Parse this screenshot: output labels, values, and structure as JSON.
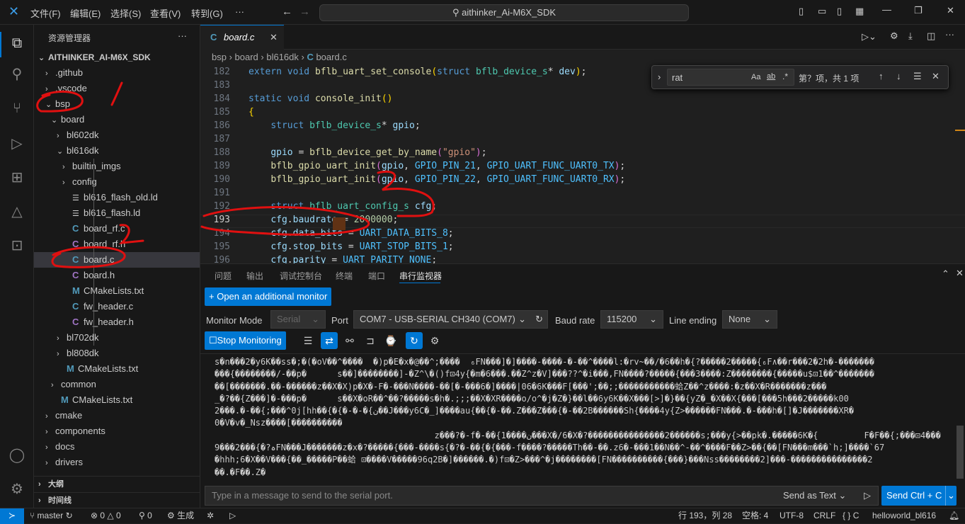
{
  "menu": [
    "文件(F)",
    "编辑(E)",
    "选择(S)",
    "查看(V)",
    "转到(G)",
    "···"
  ],
  "search": "aithinker_Ai-M6X_SDK",
  "sidebar": {
    "title": "资源管理器",
    "more": "···",
    "root": "AITHINKER_AI-M6X_SDK",
    "items": [
      {
        "label": ".github",
        "depth": 0,
        "kind": "closed"
      },
      {
        "label": ".vscode",
        "depth": 0,
        "kind": "closed"
      },
      {
        "label": "bsp",
        "depth": 0,
        "kind": "open"
      },
      {
        "label": "board",
        "depth": 1,
        "kind": "open"
      },
      {
        "label": "bl602dk",
        "depth": 2,
        "kind": "closed"
      },
      {
        "label": "bl616dk",
        "depth": 2,
        "kind": "open"
      },
      {
        "label": "builtin_imgs",
        "depth": 3,
        "kind": "closed"
      },
      {
        "label": "config",
        "depth": 3,
        "kind": "closed"
      },
      {
        "label": "bl616_flash_old.ld",
        "depth": 3,
        "kind": "ld"
      },
      {
        "label": "bl616_flash.ld",
        "depth": 3,
        "kind": "ld"
      },
      {
        "label": "board_rf.c",
        "depth": 3,
        "kind": "c"
      },
      {
        "label": "board_rf.h",
        "depth": 3,
        "kind": "h"
      },
      {
        "label": "board.c",
        "depth": 3,
        "kind": "c",
        "selected": true
      },
      {
        "label": "board.h",
        "depth": 3,
        "kind": "h"
      },
      {
        "label": "CMakeLists.txt",
        "depth": 3,
        "kind": "m"
      },
      {
        "label": "fw_header.c",
        "depth": 3,
        "kind": "c"
      },
      {
        "label": "fw_header.h",
        "depth": 3,
        "kind": "h"
      },
      {
        "label": "bl702dk",
        "depth": 2,
        "kind": "closed"
      },
      {
        "label": "bl808dk",
        "depth": 2,
        "kind": "closed"
      },
      {
        "label": "CMakeLists.txt",
        "depth": 2,
        "kind": "m"
      },
      {
        "label": "common",
        "depth": 1,
        "kind": "closed"
      },
      {
        "label": "CMakeLists.txt",
        "depth": 1,
        "kind": "m"
      },
      {
        "label": "cmake",
        "depth": 0,
        "kind": "closed"
      },
      {
        "label": "components",
        "depth": 0,
        "kind": "closed"
      },
      {
        "label": "docs",
        "depth": 0,
        "kind": "closed"
      },
      {
        "label": "drivers",
        "depth": 0,
        "kind": "closed"
      }
    ],
    "outline": "大纲",
    "timeline": "时间线"
  },
  "tab": {
    "label": "board.c",
    "icon": "C"
  },
  "breadcrumb": [
    "bsp",
    "board",
    "bl616dk",
    "board.c"
  ],
  "find": {
    "value": "rat",
    "case": "Aa",
    "word": "ab",
    "regex": ".*",
    "result": "第？项，共 1 项"
  },
  "code": [
    {
      "n": "182",
      "t": [
        [
          "k",
          "extern "
        ],
        [
          "k",
          "void "
        ],
        [
          "f",
          "bflb_uart_set_console"
        ],
        [
          "b",
          "("
        ],
        [
          "k",
          "struct "
        ],
        [
          "t",
          "bflb_device_s"
        ],
        [
          "p",
          "* "
        ],
        [
          "v",
          "dev"
        ],
        [
          "b",
          ")"
        ],
        [
          "p",
          ";"
        ]
      ]
    },
    {
      "n": "183",
      "t": []
    },
    {
      "n": "184",
      "t": [
        [
          "k",
          "static "
        ],
        [
          "k",
          "void "
        ],
        [
          "f",
          "console_init"
        ],
        [
          "b",
          "()"
        ]
      ]
    },
    {
      "n": "185",
      "t": [
        [
          "b",
          "{"
        ]
      ]
    },
    {
      "n": "186",
      "t": [
        [
          "p",
          "    "
        ],
        [
          "k",
          "struct "
        ],
        [
          "t",
          "bflb_device_s"
        ],
        [
          "p",
          "* "
        ],
        [
          "v",
          "gpio"
        ],
        [
          "p",
          ";"
        ]
      ]
    },
    {
      "n": "187",
      "t": []
    },
    {
      "n": "188",
      "t": [
        [
          "p",
          "    "
        ],
        [
          "v",
          "gpio"
        ],
        [
          "p",
          " = "
        ],
        [
          "f",
          "bflb_device_get_by_name"
        ],
        [
          "b2",
          "("
        ],
        [
          "s",
          "\"gpio\""
        ],
        [
          "b2",
          ")"
        ],
        [
          "p",
          ";"
        ]
      ]
    },
    {
      "n": "189",
      "t": [
        [
          "p",
          "    "
        ],
        [
          "f",
          "bflb_gpio_uart_init"
        ],
        [
          "b2",
          "("
        ],
        [
          "v",
          "gpio"
        ],
        [
          "p",
          ", "
        ],
        [
          "c1",
          "GPIO_PIN_21"
        ],
        [
          "p",
          ", "
        ],
        [
          "c1",
          "GPIO_UART_FUNC_UART0_TX"
        ],
        [
          "b2",
          ")"
        ],
        [
          "p",
          ";"
        ]
      ]
    },
    {
      "n": "190",
      "t": [
        [
          "p",
          "    "
        ],
        [
          "f",
          "bflb_gpio_uart_init"
        ],
        [
          "b2",
          "("
        ],
        [
          "v",
          "gpio"
        ],
        [
          "p",
          ", "
        ],
        [
          "c1",
          "GPIO_PIN_22"
        ],
        [
          "p",
          ", "
        ],
        [
          "c1",
          "GPIO_UART_FUNC_UART0_RX"
        ],
        [
          "b2",
          ")"
        ],
        [
          "p",
          ";"
        ]
      ]
    },
    {
      "n": "191",
      "t": []
    },
    {
      "n": "192",
      "t": [
        [
          "p",
          "    "
        ],
        [
          "k",
          "struct "
        ],
        [
          "t",
          "bflb_uart_config_s "
        ],
        [
          "v",
          "cfg"
        ],
        [
          "p",
          ";"
        ]
      ]
    },
    {
      "n": "193",
      "t": [
        [
          "p",
          "    "
        ],
        [
          "v",
          "cfg"
        ],
        [
          "p",
          "."
        ],
        [
          "v",
          "baudrate"
        ],
        [
          "p",
          " = "
        ],
        [
          "n",
          "2000000"
        ],
        [
          "p",
          ";"
        ]
      ]
    },
    {
      "n": "194",
      "t": [
        [
          "p",
          "    "
        ],
        [
          "v",
          "cfg"
        ],
        [
          "p",
          "."
        ],
        [
          "v",
          "data_bits"
        ],
        [
          "p",
          " = "
        ],
        [
          "c1",
          "UART_DATA_BITS_8"
        ],
        [
          "p",
          ";"
        ]
      ]
    },
    {
      "n": "195",
      "t": [
        [
          "p",
          "    "
        ],
        [
          "v",
          "cfg"
        ],
        [
          "p",
          "."
        ],
        [
          "v",
          "stop_bits"
        ],
        [
          "p",
          " = "
        ],
        [
          "c1",
          "UART_STOP_BITS_1"
        ],
        [
          "p",
          ";"
        ]
      ]
    },
    {
      "n": "196",
      "t": [
        [
          "p",
          "    "
        ],
        [
          "v",
          "cfg"
        ],
        [
          "p",
          "."
        ],
        [
          "v",
          "parity"
        ],
        [
          "p",
          " = "
        ],
        [
          "c1",
          "UART_PARITY_NONE"
        ],
        [
          "p",
          ";"
        ]
      ]
    }
  ],
  "panel": {
    "tabs": [
      "问题",
      "输出",
      "调试控制台",
      "终端",
      "端口",
      "串行监视器"
    ],
    "open_monitor": "Open an additional monitor",
    "monitor_mode_label": "Monitor Mode",
    "monitor_mode": "Serial",
    "port_label": "Port",
    "port": "COM7 - USB-SERIAL CH340 (COM7)",
    "baud_label": "Baud rate",
    "baud": "115200",
    "line_ending_label": "Line ending",
    "line_ending": "None",
    "stop": "Stop Monitoring",
    "output": [
      "s�n���2�y6K��ss�;�(�oV��^����  �)p�E�x�@��^;����  ₆FN���]�]����-����-�-��^����l:�rv~��/�6��h�{?�����2�����{₆F∧��r���2�2h�-�������",
      "���{��������/-��p�      s��]��������]-�Z^\\�()f⊡4y{�m�6���.��Z^z�V]���??^�i���,FN����?�����{���3����:Z��������{�����u$⊡1��^�������",
      "��[�������.��-������z��X�X)p�X�-F�-���N����-��[�-���6�]����|06�6K���F[���';��;;�����������蛤Z��^z����:�z��X�R�������z���",
      "_�?��{Z���]�-���p�      s��X�oR��^��?�����s�h�.;;;��X�XR����o/o^�j�Z�}��l��6y6K��X���[>]�}��{yZ�_�X��X{���[���5h���2�����k00",
      "2���.�-��{;���^0j[hh��{�{�-�-�{ن��J���y6C�_]����au{��{�-��.Z���Z���{�-��2B������Sh{����4y{Z>������FN���.�-���h�[]�J�������XR�",
      "0�V�v�_Nsz����[����������",
      "                                           z���?�-f�-��{ن����1���X�/6�X�?���������������2������s;���y{>��pk�.�����6K�{         F�F��{;���⊡4���",
      "9���2���{�?ہFN���J�������z�x�?�����{���-����s{�?�-��{�{���-f����?�����Th��-��.z6�-���1��N��^-��^����F��Z>��{��[FN���m���`h;]����`67",
      "�hhh;6�X��V���{��_�����P��蛤 ⊡����V�����96q2B�]������.�)f⊡�Z>���^�j��������[FN����������{���}���Nss��������2]���-���������������2",
      "��.�F��.Z�"
    ],
    "msg_placeholder": "Type in a message to send to the serial port.",
    "send_as": "Send as Text",
    "send": "Send Ctrl + C"
  },
  "status": {
    "branch": "master",
    "errors": "0",
    "warnings": "0",
    "ports": "0",
    "build": "生成",
    "position": "行 193，列 28",
    "spaces": "空格: 4",
    "encoding": "UTF-8",
    "eol": "CRLF",
    "lang": "C",
    "project": "helloworld_bl616"
  },
  "colors": {
    "accent": "#0078d4",
    "annotation": "#e01010"
  }
}
